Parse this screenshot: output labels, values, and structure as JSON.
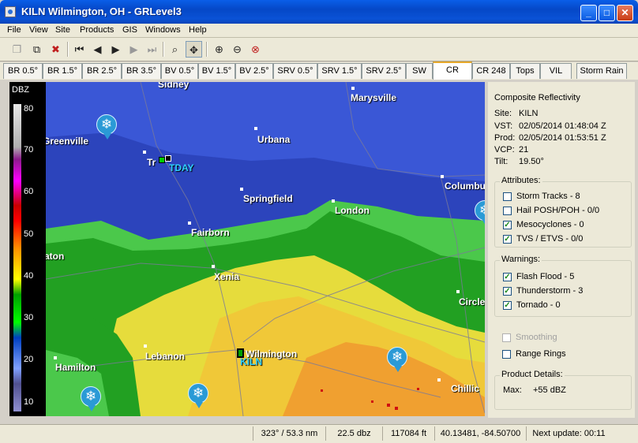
{
  "window": {
    "title": "KILN Wilmington, OH - GRLevel3",
    "minimize": "_",
    "maximize": "□",
    "close": "✕"
  },
  "menu": [
    "File",
    "View",
    "Site",
    "Products",
    "GIS",
    "Windows",
    "Help"
  ],
  "toolbar_icons": [
    "new-window-icon",
    "copy-icon",
    "delete-icon",
    "first-frame-icon",
    "previous-frame-icon",
    "play-icon",
    "next-frame-icon",
    "last-frame-icon",
    "zoom-tool-icon",
    "pan-tool-icon",
    "zoom-in-icon",
    "zoom-out-icon",
    "zoom-reset-icon"
  ],
  "tabs": [
    "BR 0.5°",
    "BR 1.5°",
    "BR 2.5°",
    "BR 3.5°",
    "BV 0.5°",
    "BV 1.5°",
    "BV 2.5°",
    "SRV 0.5°",
    "SRV 1.5°",
    "SRV 2.5°",
    "SW",
    "CR",
    "CR 248",
    "Tops",
    "VIL",
    "Storm Rain"
  ],
  "selected_tab": "CR",
  "legend": {
    "header": "DBZ",
    "ticks": [
      "80",
      "70",
      "60",
      "50",
      "40",
      "30",
      "20",
      "10"
    ]
  },
  "map": {
    "cities": [
      "Sidney",
      "Marysville",
      "Greenville",
      "Urbana",
      "Troy",
      "Springfield",
      "Columbus",
      "London",
      "Fairborn",
      "Dayton",
      "Xenia",
      "Circleville",
      "Hamilton",
      "Lebanon",
      "Wilmington",
      "Chillicothe"
    ],
    "shown_city_labels": [
      "Sidney",
      "Marysville",
      "Greenville",
      "Urbana",
      "Tr",
      "Springfield",
      "Columbu",
      "London",
      "Fairborn",
      "aton",
      "Xenia",
      "Circle",
      "Hamilton",
      "Lebanon",
      "Wilmington",
      "Chillic"
    ],
    "site_label": "KILN",
    "marker_label": "TDAY",
    "marker_icon": "snowflake-icon"
  },
  "product": {
    "name": "Composite Reflectivity",
    "site_label": "Site:",
    "site": "KILN",
    "vst_label": "VST:",
    "vst": "02/05/2014  01:48:04 Z",
    "prod_label": "Prod:",
    "prod": "02/05/2014  01:53:51 Z",
    "vcp_label": "VCP:",
    "vcp": "21",
    "tilt_label": "Tilt:",
    "tilt": "19.50°"
  },
  "attributes": {
    "title": "Attributes:",
    "items": [
      {
        "label": "Storm Tracks - 8",
        "checked": false
      },
      {
        "label": "Hail POSH/POH - 0/0",
        "checked": false
      },
      {
        "label": "Mesocyclones - 0",
        "checked": true
      },
      {
        "label": "TVS / ETVS - 0/0",
        "checked": true
      }
    ]
  },
  "warnings": {
    "title": "Warnings:",
    "items": [
      {
        "label": "Flash Flood - 5",
        "checked": true
      },
      {
        "label": "Thunderstorm - 3",
        "checked": true
      },
      {
        "label": "Tornado - 0",
        "checked": true
      }
    ]
  },
  "options": [
    {
      "label": "Smoothing",
      "checked": false,
      "disabled": true
    },
    {
      "label": "Range Rings",
      "checked": false,
      "disabled": false
    }
  ],
  "details": {
    "title": "Product Details:",
    "max_label": "Max:",
    "max": "+55 dBZ"
  },
  "status": {
    "polar": "323° / 53.3 nm",
    "value": "22.5 dbz",
    "height": "117084 ft",
    "latlon": "40.13481, -84.50700",
    "next_update": "Next update: 00:11"
  },
  "colors": {
    "light_blue": "#3451d1",
    "deep_blue": "#2a42b8",
    "green": "#20b020",
    "bright_green": "#4cd64c",
    "yellow": "#e8e040",
    "orange": "#f0a030",
    "red": "#d01010"
  }
}
